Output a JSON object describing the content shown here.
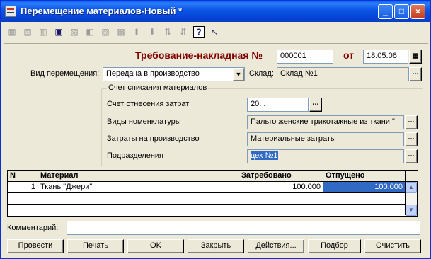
{
  "window": {
    "title": "Перемещение материалов-Новый *",
    "controls": {
      "minimize": "_",
      "maximize": "□",
      "close": "×"
    }
  },
  "toolbar": {
    "icons": [
      "new-row-icon",
      "copy-row-icon",
      "edit-row-icon",
      "save-icon",
      "delete-row-icon",
      "find-icon",
      "mark-icon",
      "tree-icon",
      "up-arrow-icon",
      "down-arrow-icon",
      "sort-asc-icon",
      "sort-desc-icon",
      "help-icon",
      "pointer-help-icon"
    ]
  },
  "header": {
    "doc_title": "Требование-накладная №",
    "doc_number": "000001",
    "date_label": "от",
    "date": "18.05.06"
  },
  "movement": {
    "label": "Вид перемещения:",
    "value": "Передача в производство",
    "warehouse_label": "Склад:",
    "warehouse_value": "Склад №1"
  },
  "writeoff": {
    "group_title": "Счет списания материалов",
    "account_label": "Счет отнесения затрат",
    "account_value": "20. .",
    "nomenclature_label": "Виды номенклатуры",
    "nomenclature_value": "Пальто женские трикотажные из ткани \"",
    "costs_label": "Затраты на производство",
    "costs_value": "Материальные затраты",
    "division_label": "Подразделения",
    "division_value": "цех №1"
  },
  "table": {
    "columns": [
      "N",
      "Материал",
      "Затребовано",
      "Отпущено"
    ],
    "rows": [
      [
        "1",
        "Ткань \"Джери\"",
        "100.000",
        "100.000"
      ]
    ]
  },
  "comment": {
    "label": "Комментарий:",
    "value": ""
  },
  "buttons": {
    "post": "Провести",
    "print": "Печать",
    "ok": "OK",
    "close": "Закрыть",
    "actions": "Действия...",
    "select": "Подбор",
    "clear": "Очистить"
  }
}
